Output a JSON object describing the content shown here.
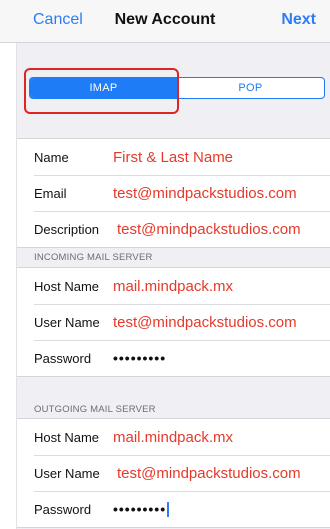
{
  "navbar": {
    "cancel_label": "Cancel",
    "title": "New Account",
    "next_label": "Next"
  },
  "segmented": {
    "options": [
      "IMAP",
      "POP"
    ],
    "selected": "IMAP"
  },
  "account": {
    "name_label": "Name",
    "name_value": "First & Last Name",
    "email_label": "Email",
    "email_value": "test@mindpackstudios.com",
    "description_label": "Description",
    "description_value": "test@mindpackstudios.com"
  },
  "incoming": {
    "header": "INCOMING MAIL SERVER",
    "host_label": "Host Name",
    "host_value": "mail.mindpack.mx",
    "user_label": "User Name",
    "user_value": "test@mindpackstudios.com",
    "password_label": "Password",
    "password_value": "•••••••••"
  },
  "outgoing": {
    "header": "OUTGOING MAIL SERVER",
    "host_label": "Host Name",
    "host_value": "mail.mindpack.mx",
    "user_label": "User Name",
    "user_value": "test@mindpackstudios.com",
    "password_label": "Password",
    "password_value": "•••••••••"
  },
  "colors": {
    "accent": "#1e7cf6",
    "annotation": "#e53a2b",
    "highlight_box": "#e02424"
  }
}
